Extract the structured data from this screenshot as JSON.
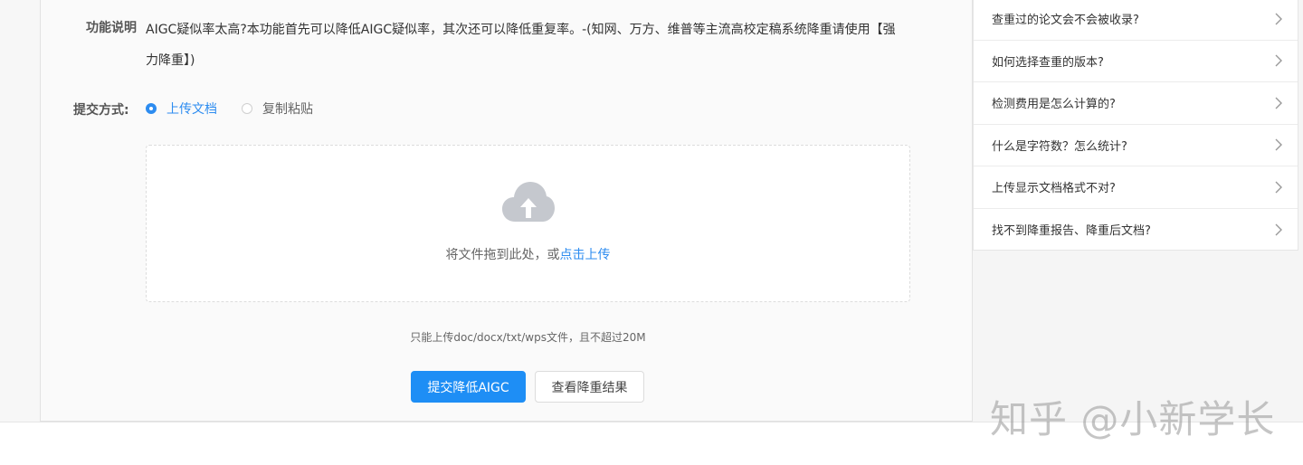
{
  "form": {
    "description_label": "功能说明",
    "description_text": "AIGC疑似率太高?本功能首先可以降低AIGC疑似率，其次还可以降低重复率。-(知网、万方、维普等主流高校定稿系统降重请使用【强力降重】)",
    "submit_method_label": "提交方式:",
    "options": [
      {
        "label": "上传文档",
        "selected": true
      },
      {
        "label": "复制粘贴",
        "selected": false
      }
    ],
    "upload": {
      "icon": "cloud-upload-icon",
      "text_prefix": "将文件拖到此处，或",
      "text_link": "点击上传"
    },
    "hint": "只能上传doc/docx/txt/wps文件，且不超过20M",
    "submit_button": "提交降低AIGC",
    "view_result_button": "查看降重结果"
  },
  "faq": {
    "items": [
      {
        "question": "查重过的论文会不会被收录?"
      },
      {
        "question": "如何选择查重的版本?"
      },
      {
        "question": "检测费用是怎么计算的?"
      },
      {
        "question": "什么是字符数？怎么统计?"
      },
      {
        "question": "上传显示文档格式不对?"
      },
      {
        "question": "找不到降重报告、降重后文档?"
      }
    ]
  },
  "watermark": "知乎 @小新学长",
  "colors": {
    "accent": "#2d8cf0",
    "primary_button": "#1e8ef5",
    "icon_gray": "#c5c8ce"
  }
}
